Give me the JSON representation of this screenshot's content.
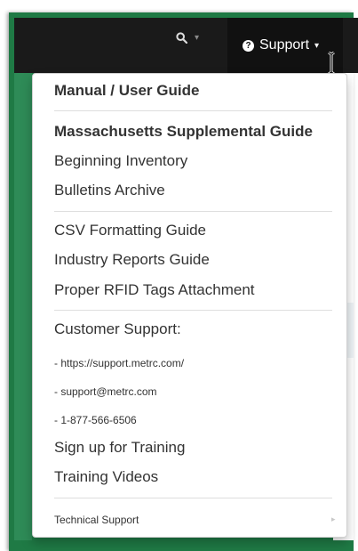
{
  "navbar": {
    "search_caret": "▾",
    "support_label": "Support",
    "support_caret": "▾"
  },
  "menu": {
    "manual": "Manual / User Guide",
    "supplemental": "Massachusetts Supplemental Guide",
    "beginning_inventory": "Beginning Inventory",
    "bulletins": "Bulletins Archive",
    "csv_guide": "CSV Formatting Guide",
    "industry_reports": "Industry Reports Guide",
    "rfid_tags": "Proper RFID Tags Attachment",
    "customer_support": "Customer Support:",
    "support_url": "- https://support.metrc.com/",
    "support_email": "- support@metrc.com",
    "support_phone": "- 1-877-566-6506",
    "sign_up_training": "Sign up for Training",
    "training_videos": "Training Videos",
    "technical_support": "Technical Support",
    "technical_support_arrow": "▸"
  },
  "colors": {
    "navbar_bg": "#1a1a1a",
    "support_tab_bg": "#111111",
    "frame_green": "#1f7a45",
    "menu_text": "#333333"
  }
}
